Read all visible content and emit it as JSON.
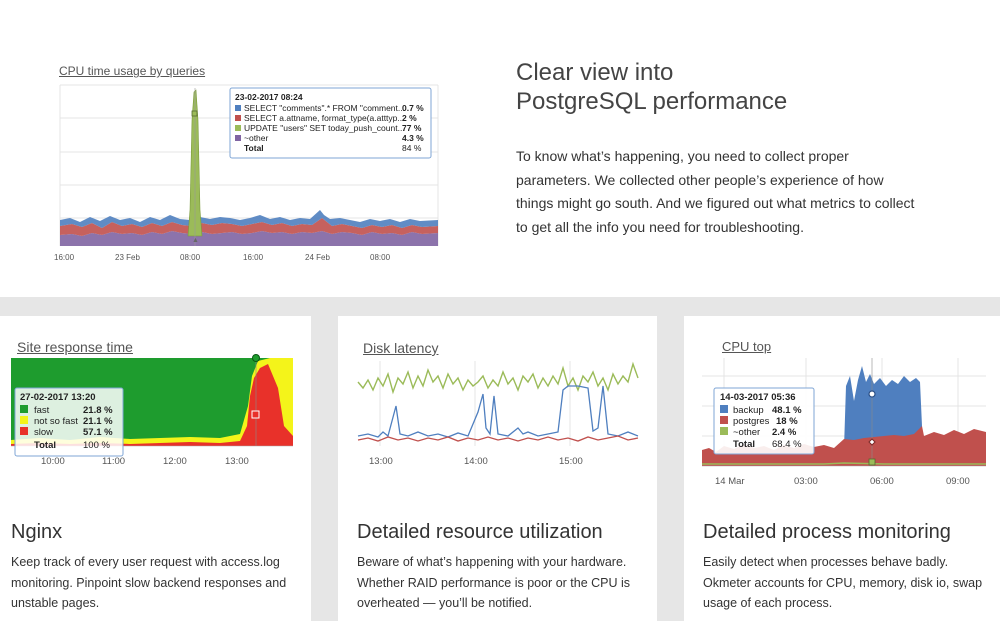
{
  "hero": {
    "chart_title": "CPU time usage by queries",
    "heading_line1": "Clear view into",
    "heading_line2": "PostgreSQL performance",
    "description": "To know what’s happening, you need to collect proper parameters. We collected other people’s experience of how things might go south. And we figured out what metrics to collect to get all the info you need for troubleshooting.",
    "x_ticks": [
      "16:00",
      "23 Feb",
      "08:00",
      "16:00",
      "24 Feb",
      "08:00"
    ],
    "tooltip": {
      "date": "23-02-2017 08:24",
      "rows": [
        {
          "label": "SELECT \"comments\".* FROM \"comment...",
          "value": "0.7 %",
          "color": "#4f7fbf"
        },
        {
          "label": "SELECT a.attname, format_type(a.atttyp...",
          "value": "2 %",
          "color": "#c0504d"
        },
        {
          "label": "UPDATE \"users\" SET today_push_count...",
          "value": "77 %",
          "color": "#9bbb59"
        },
        {
          "label": "~other",
          "value": "4.3 %",
          "color": "#8064a2"
        }
      ],
      "total_label": "Total",
      "total_value": "84 %"
    }
  },
  "cards": {
    "nginx": {
      "chart_title": "Site response time",
      "title": "Nginx",
      "description": "Keep track of every user request with access.log monitoring. Pinpoint slow backend responses and unstable pages.",
      "x_ticks": [
        "10:00",
        "11:00",
        "12:00",
        "13:00"
      ],
      "tooltip": {
        "date": "27-02-2017 13:20",
        "rows": [
          {
            "label": "fast",
            "value": "21.8 %",
            "color": "#1e9c2e"
          },
          {
            "label": "not so fast",
            "value": "21.1 %",
            "color": "#f4f41a"
          },
          {
            "label": "slow",
            "value": "57.1 %",
            "color": "#e8312a"
          }
        ],
        "total_label": "Total",
        "total_value": "100 %"
      }
    },
    "disk": {
      "chart_title": "Disk latency",
      "title": "Detailed resource utilization",
      "description": "Beware of what’s happening with your hardware. Whether RAID performance is poor or the CPU is overheated — you’ll be notified.",
      "x_ticks": [
        "13:00",
        "14:00",
        "15:00"
      ]
    },
    "cpu": {
      "chart_title": "CPU top",
      "title": "Detailed process monitoring",
      "description": "Easily detect when processes behave badly. Okmeter accounts for CPU, memory, disk io, swap usage of each process.",
      "x_ticks": [
        "14 Mar",
        "03:00",
        "06:00",
        "09:00"
      ],
      "tooltip": {
        "date": "14-03-2017 05:36",
        "rows": [
          {
            "label": "backup",
            "value": "48.1 %",
            "color": "#4f7fbf"
          },
          {
            "label": "postgres",
            "value": "18 %",
            "color": "#c0504d"
          },
          {
            "label": "~other",
            "value": "2.4 %",
            "color": "#9bbb59"
          }
        ],
        "total_label": "Total",
        "total_value": "68.4 %"
      }
    }
  }
}
